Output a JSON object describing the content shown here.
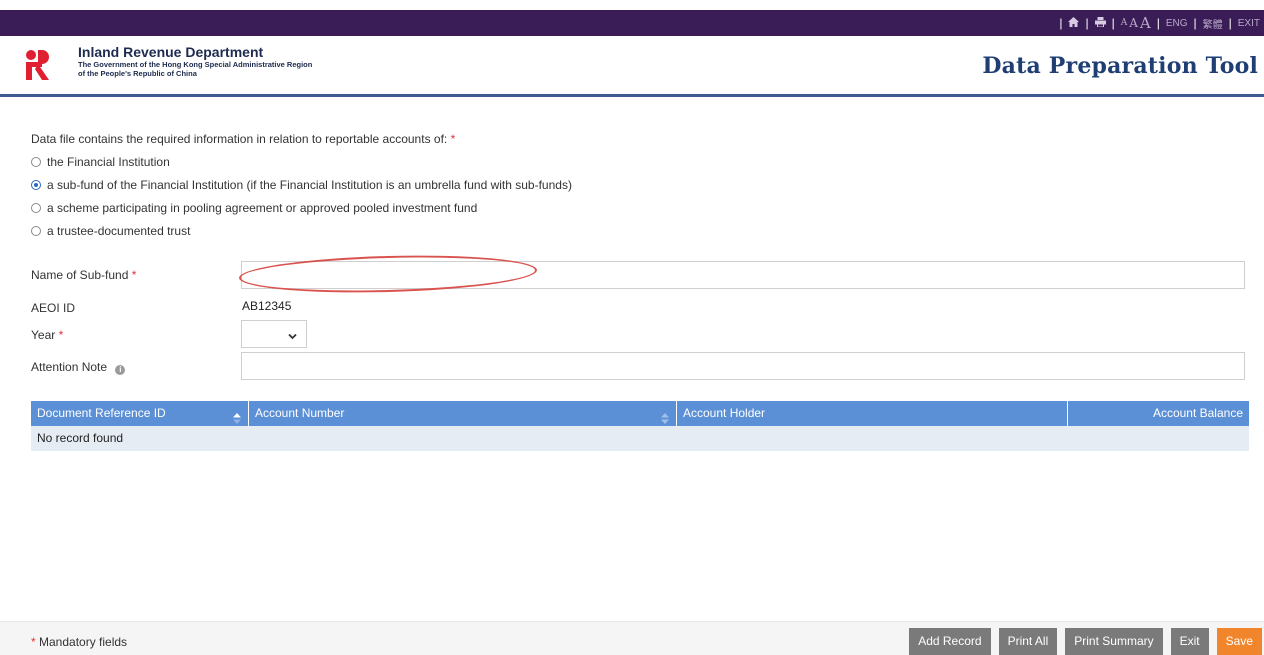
{
  "topbar": {
    "font_small": "A",
    "font_medium": "A",
    "font_large": "A",
    "lang_eng": "ENG",
    "lang_tc": "繁體",
    "exit": "EXIT",
    "home_icon": "home-icon",
    "print_icon": "print-icon"
  },
  "header": {
    "dept_name": "Inland Revenue Department",
    "dept_sub1": "The Government of the Hong Kong Special Administrative Region",
    "dept_sub2": "of the People's Republic of China",
    "tool_title": "Data Preparation Tool"
  },
  "form": {
    "question": "Data file contains the required information in relation to reportable accounts of:",
    "required_mark": "*",
    "options": [
      {
        "label": "the Financial Institution",
        "selected": false
      },
      {
        "label": "a sub-fund of the Financial Institution (if the Financial Institution is an umbrella fund with sub-funds)",
        "selected": true
      },
      {
        "label": "a scheme participating in pooling agreement or approved pooled investment fund",
        "selected": false
      },
      {
        "label": "a trustee-documented trust",
        "selected": false
      }
    ],
    "subfund_label": "Name of Sub-fund",
    "subfund_value": "",
    "aeoi_label": "AEOI ID",
    "aeoi_value": "AB12345",
    "year_label": "Year",
    "year_value": "",
    "attention_label": "Attention Note",
    "attention_value": ""
  },
  "table": {
    "columns": [
      "Document Reference ID",
      "Account Number",
      "Account Holder",
      "Account Balance"
    ],
    "empty_text": "No record found"
  },
  "footer": {
    "mandatory_mark": "*",
    "mandatory_text": "Mandatory fields",
    "buttons": [
      "Add Record",
      "Print All",
      "Print Summary",
      "Exit",
      "Save"
    ]
  },
  "colors": {
    "topbar": "#3a1d57",
    "table_header": "#5b8fd6",
    "save_button": "#f0852b",
    "annotation_ellipse": "#d9534f"
  }
}
